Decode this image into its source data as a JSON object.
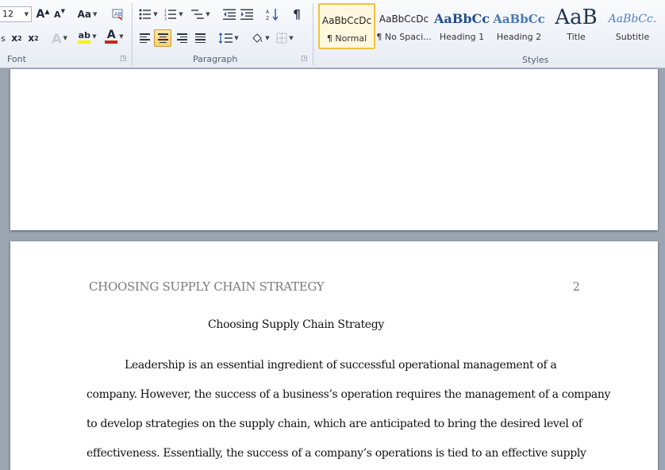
{
  "ribbon": {
    "font_group": {
      "label": "Font",
      "font_size": "12",
      "grow_font": "A",
      "shrink_font": "A",
      "change_case": "Aa",
      "subscript": "x",
      "superscript": "x",
      "font_color_glyph": "A",
      "highlight_glyph": "ab"
    },
    "paragraph_group": {
      "label": "Paragraph",
      "pilcrow": "¶"
    },
    "styles_group": {
      "label": "Styles",
      "items": [
        {
          "sample": "AaBbCcDc",
          "name": "¶ Normal"
        },
        {
          "sample": "AaBbCcDc",
          "name": "¶ No Spaci..."
        },
        {
          "sample": "AaBbCc",
          "name": "Heading 1"
        },
        {
          "sample": "AaBbCc",
          "name": "Heading 2"
        },
        {
          "sample": "AaB",
          "name": "Title"
        },
        {
          "sample": "AaBbCc.",
          "name": "Subtitle"
        }
      ]
    },
    "colors": {
      "font_color": "#d2231f",
      "highlight_color": "#f6f200",
      "selection": "#f0c040"
    }
  },
  "document": {
    "running_head": "CHOOSING SUPPLY CHAIN STRATEGY",
    "page_number": "2",
    "title": "Choosing Supply Chain Strategy",
    "paragraph_lines": [
      "Leadership is an essential ingredient of successful operational management of a",
      "company. However, the success of a business’s operation requires the management of a company",
      "to develop strategies on the supply chain, which are anticipated to bring the desired level of",
      "effectiveness. Essentially, the success of a company’s operations is tied to an effective supply"
    ]
  }
}
